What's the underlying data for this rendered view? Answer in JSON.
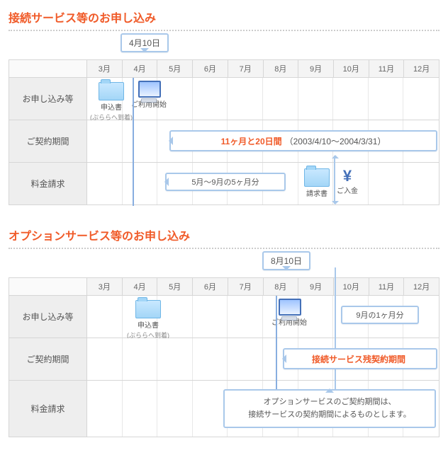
{
  "months": [
    "3月",
    "4月",
    "5月",
    "6月",
    "7月",
    "8月",
    "9月",
    "10月",
    "11月",
    "12月"
  ],
  "rowheads": {
    "apply": "お申し込み等",
    "period": "ご契約期間",
    "billing": "料金請求"
  },
  "sec1": {
    "title": "接続サービス等のお申し込み",
    "date_callout": "4月10日",
    "apply_icon1": {
      "l1": "申込書",
      "l2": "(ぷららへ到着)"
    },
    "apply_icon2": {
      "l1": "ご利用開始"
    },
    "period_bar": {
      "em": "11ヶ月と20日間",
      "rest": "（2003/4/10〜2004/3/31）"
    },
    "billing_box": "5月〜9月の5ヶ月分",
    "billing_icon1": "請求書",
    "billing_icon2": "ご入金"
  },
  "sec2": {
    "title": "オプションサービス等のお申し込み",
    "date_callout": "8月10日",
    "apply_icon1": {
      "l1": "申込書",
      "l2": "(ぷららへ到着)"
    },
    "apply_icon2": {
      "l1": "ご利用開始"
    },
    "side_box": "9月の1ヶ月分",
    "period_bar": {
      "em": "接続サービス残契約期間"
    },
    "note": {
      "l1": "オプションサービスのご契約期間は、",
      "l2": "接続サービスの契約期間によるものとします。"
    }
  }
}
